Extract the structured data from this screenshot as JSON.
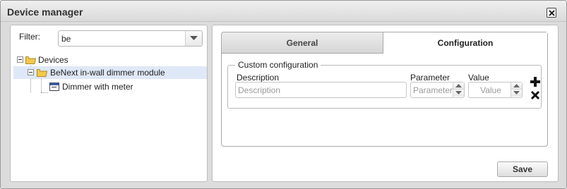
{
  "window": {
    "title": "Device manager"
  },
  "filter": {
    "label": "Filter:",
    "value": "be"
  },
  "tree": {
    "root_label": "Devices",
    "module_label": "BeNext in-wall dimmer module",
    "child_label": "Dimmer with meter"
  },
  "tabs": [
    {
      "label": "General",
      "active": false
    },
    {
      "label": "Configuration",
      "active": true
    }
  ],
  "config": {
    "legend": "Custom configuration",
    "columns": {
      "description": "Description",
      "parameter": "Parameter",
      "value": "Value"
    },
    "placeholders": {
      "description": "Description",
      "parameter": "Parameter",
      "value": "Value"
    }
  },
  "buttons": {
    "save": "Save"
  },
  "colors": {
    "selected_row": "#dfe8f6",
    "folder": "#f2c94c",
    "device_icon_bar": "#3a5da8"
  },
  "icons": {
    "close": "close-icon",
    "filter_dropdown": "chevron-down-icon",
    "tree_expander": "minus-expander-icon",
    "folder": "folder-icon",
    "device": "device-icon",
    "add": "plus-icon",
    "remove": "x-icon"
  }
}
